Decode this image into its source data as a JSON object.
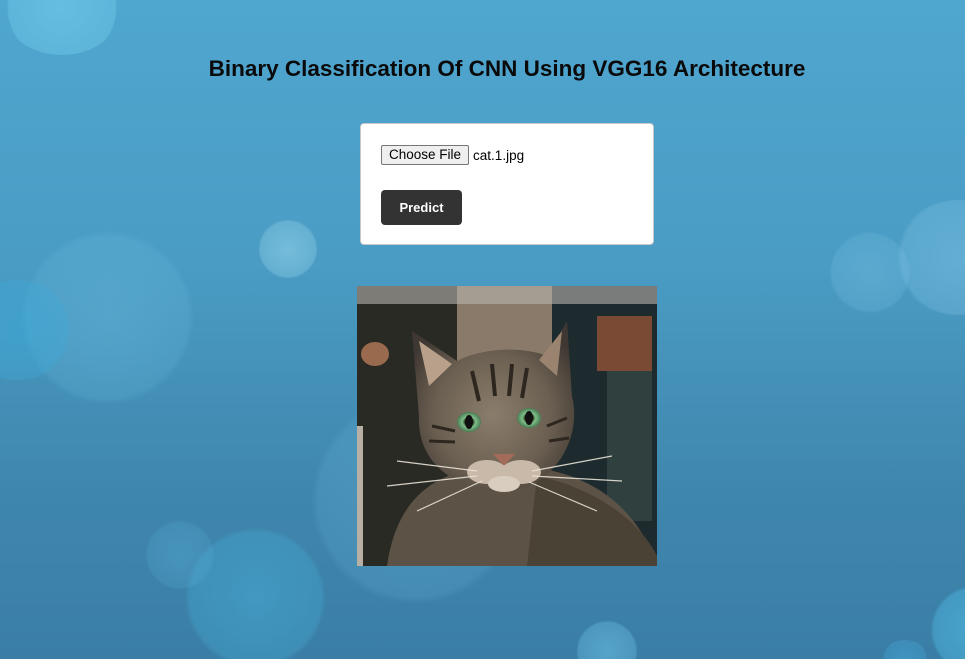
{
  "page": {
    "title": "Binary Classification Of CNN Using VGG16 Architecture"
  },
  "upload_form": {
    "choose_file_label": "Choose File",
    "selected_file_name": "cat.1.jpg",
    "predict_label": "Predict"
  },
  "preview": {
    "subject": "tabby cat photo"
  },
  "colors": {
    "background": "#4a9cc4",
    "card": "#ffffff",
    "predict_button": "#333333",
    "title_text": "#0a0a0a"
  }
}
